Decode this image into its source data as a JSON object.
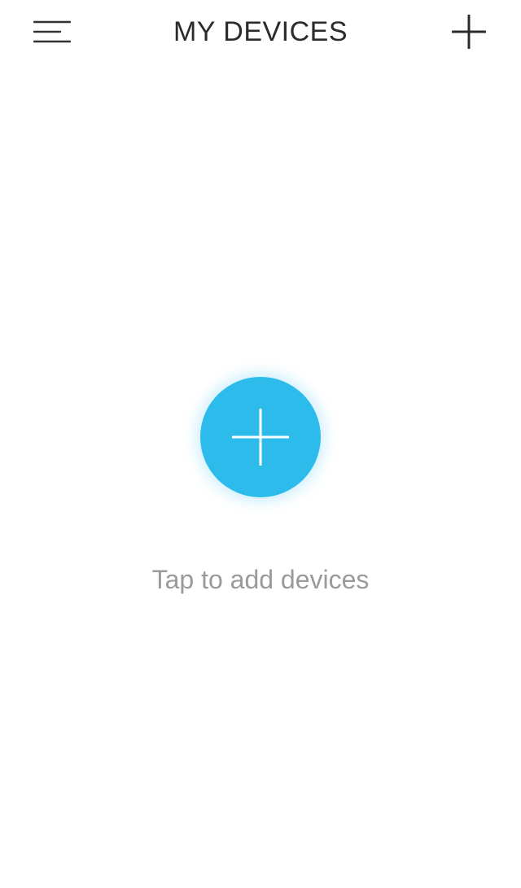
{
  "header": {
    "title": "MY DEVICES",
    "menu_icon": "menu-icon",
    "add_icon": "plus-icon"
  },
  "empty_state": {
    "fab_icon": "plus-icon",
    "hint": "Tap to add devices"
  },
  "colors": {
    "accent": "#2dbbec",
    "title": "#2b2b2b",
    "hint": "#9a9a9a",
    "background": "#ffffff"
  }
}
